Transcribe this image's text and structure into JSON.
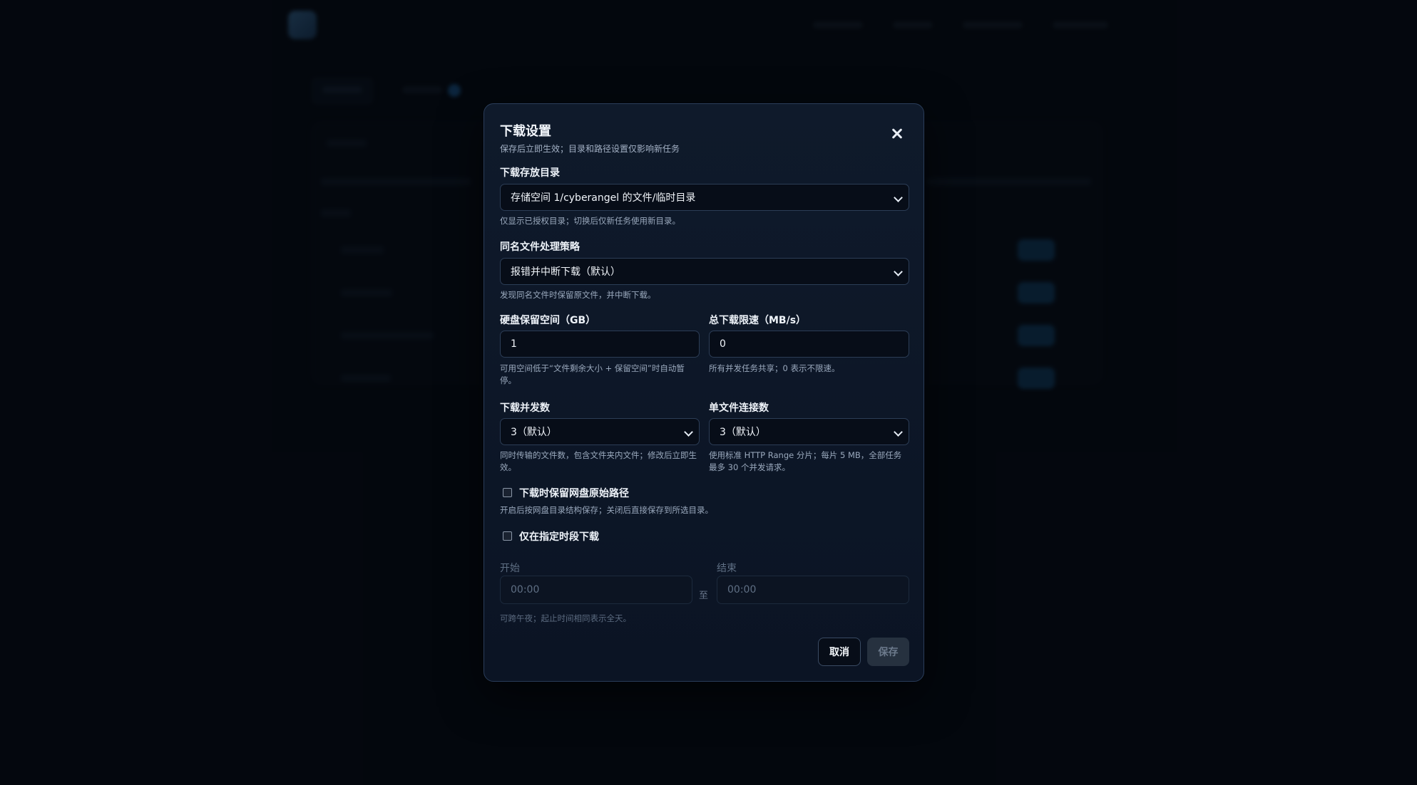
{
  "modal": {
    "title": "下载设置",
    "subtitle": "保存后立即生效；目录和路径设置仅影响新任务",
    "directory": {
      "label": "下载存放目录",
      "value": "存储空间 1/cyberangel 的文件/临时目录",
      "hint": "仅显示已授权目录；切换后仅新任务使用新目录。"
    },
    "conflict": {
      "label": "同名文件处理策略",
      "value": "报错并中断下载（默认）",
      "hint": "发现同名文件时保留原文件，并中断下载。"
    },
    "reserve": {
      "label": "硬盘保留空间（GB）",
      "value": "1",
      "hint": "可用空间低于“文件剩余大小 + 保留空间”时自动暂停。"
    },
    "speed": {
      "label": "总下载限速（MB/s）",
      "value": "0",
      "hint": "所有并发任务共享；0 表示不限速。"
    },
    "concurrency": {
      "label": "下载并发数",
      "value": "3（默认）",
      "hint": "同时传输的文件数，包含文件夹内文件；修改后立即生效。"
    },
    "connections": {
      "label": "单文件连接数",
      "value": "3（默认）",
      "hint": "使用标准 HTTP Range 分片；每片 5 MB，全部任务最多 30 个并发请求。"
    },
    "keep_path": {
      "label": "下载时保留网盘原始路径",
      "checked": false,
      "hint": "开启后按网盘目录结构保存；关闭后直接保存到所选目录。"
    },
    "schedule": {
      "label": "仅在指定时段下载",
      "checked": false,
      "start_label": "开始",
      "start_value": "00:00",
      "end_label": "结束",
      "end_value": "00:00",
      "to": "至",
      "hint": "可跨午夜；起止时间相同表示全天。"
    },
    "cancel_label": "取消",
    "save_label": "保存"
  },
  "colors": {
    "background": "#060a12",
    "modal": "#0f1a2b",
    "accent": "#2b86d9"
  }
}
